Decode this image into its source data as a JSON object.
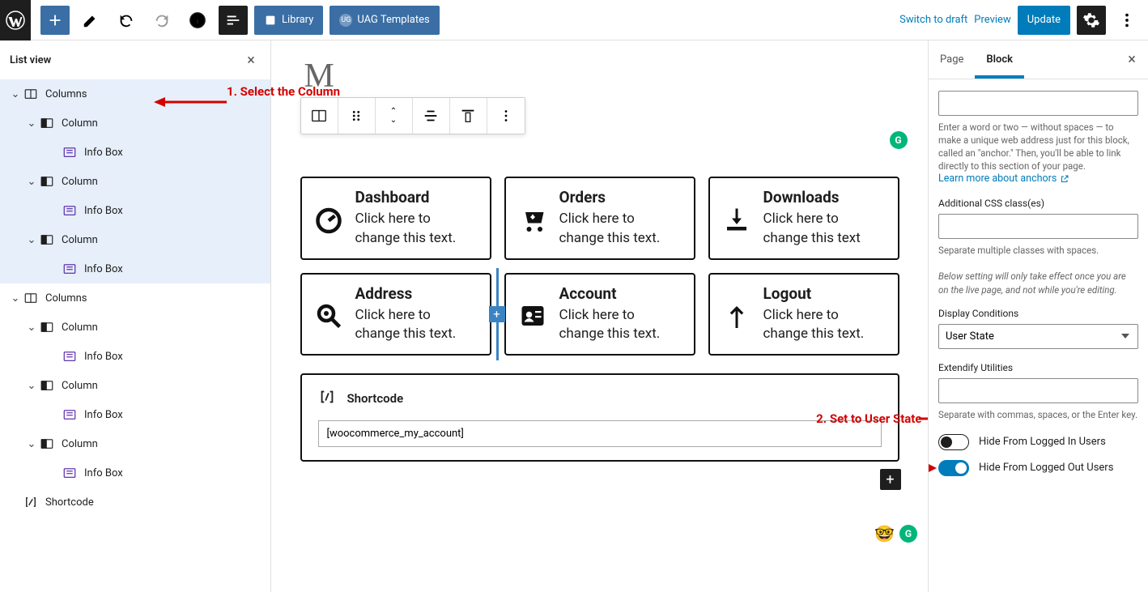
{
  "topbar": {
    "library": "Library",
    "uag": "UAG Templates",
    "switch": "Switch to draft",
    "preview": "Preview",
    "update": "Update"
  },
  "listview": {
    "title": "List view",
    "items": {
      "columns": "Columns",
      "column": "Column",
      "infobox": "Info Box",
      "shortcode": "Shortcode"
    }
  },
  "annot": {
    "one": "1. Select the Column",
    "two": "2. Set to User State"
  },
  "canvas": {
    "title_shadow": "M",
    "cards": [
      {
        "title": "Dashboard",
        "text": "Click here to change this text."
      },
      {
        "title": "Orders",
        "text": "Click here to change this text."
      },
      {
        "title": "Downloads",
        "text": "Click here to change this text"
      },
      {
        "title": "Address",
        "text": "Click here to change this text."
      },
      {
        "title": "Account",
        "text": "Click here to change this text."
      },
      {
        "title": "Logout",
        "text": "Click here to change this text."
      }
    ],
    "shortcode": {
      "label": "Shortcode",
      "value": "[woocommerce_my_account]"
    }
  },
  "sidebar": {
    "tabs": {
      "page": "Page",
      "block": "Block"
    },
    "anchor_help": "Enter a word or two — without spaces — to make a unique web address just for this block, called an \"anchor.\" Then, you'll be able to link directly to this section of your page.",
    "anchor_link": "Learn more about anchors",
    "css_label": "Additional CSS class(es)",
    "css_help": "Separate multiple classes with spaces.",
    "note": "Below setting will only take effect once you are on the live page, and not while you're editing.",
    "display_label": "Display Conditions",
    "display_value": "User State",
    "extendify_label": "Extendify Utilities",
    "extendify_help": "Separate with commas, spaces, or the Enter key.",
    "hide_in": "Hide From Logged In Users",
    "hide_out": "Hide From Logged Out Users"
  }
}
